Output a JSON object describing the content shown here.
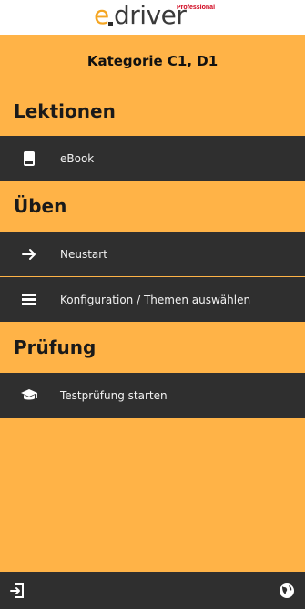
{
  "header": {
    "logo_text_e": "e",
    "logo_text_driver": "driver",
    "logo_text_pro": "Professional",
    "category": "Kategorie C1, D1"
  },
  "sections": [
    {
      "title": "Lektionen",
      "items": [
        {
          "label": "eBook",
          "icon": "book-icon"
        }
      ]
    },
    {
      "title": "Üben",
      "items": [
        {
          "label": "Neustart",
          "icon": "arrow-right-icon"
        },
        {
          "label": "Konfiguration / Themen auswählen",
          "icon": "list-icon"
        }
      ]
    },
    {
      "title": "Prüfung",
      "items": [
        {
          "label": "Testprüfung starten",
          "icon": "graduation-cap-icon"
        }
      ]
    }
  ],
  "footer": {
    "left_icon": "logout-icon",
    "right_icon": "globe-icon"
  },
  "colors": {
    "accent": "#FFB347",
    "bar": "#2f2f2f",
    "logo_orange": "#F5A623",
    "pro_red": "#d0021b"
  }
}
